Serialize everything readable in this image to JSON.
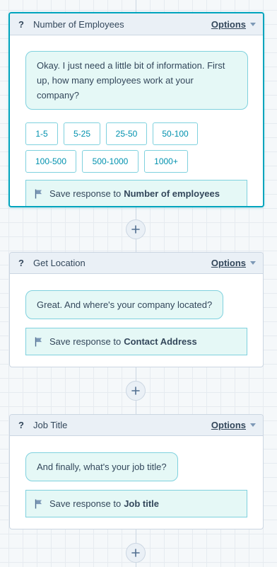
{
  "add_button_symbol": "+",
  "cards": [
    {
      "title": "Number of Employees",
      "question_mark": "?",
      "options_label": "Options",
      "bubble": "Okay. I just need a little bit of information. First up, how many employees work at your company?",
      "quick_replies": [
        "1-5",
        "5-25",
        "25-50",
        "50-100",
        "100-500",
        "500-1000",
        "1000+"
      ],
      "save_prefix": "Save response to",
      "save_target": "Number of employees"
    },
    {
      "title": "Get Location",
      "question_mark": "?",
      "options_label": "Options",
      "bubble": "Great. And where's your company located?",
      "save_prefix": "Save response to",
      "save_target": "Contact Address"
    },
    {
      "title": "Job Title",
      "question_mark": "?",
      "options_label": "Options",
      "bubble": "And finally, what's your job title?",
      "save_prefix": "Save response to",
      "save_target": "Job title"
    }
  ],
  "colors": {
    "accent": "#00a4bd",
    "bubble_bg": "#e5f8f6",
    "bubble_border": "#7fd1de",
    "text": "#33475b",
    "header_bg": "#eaf0f6"
  }
}
